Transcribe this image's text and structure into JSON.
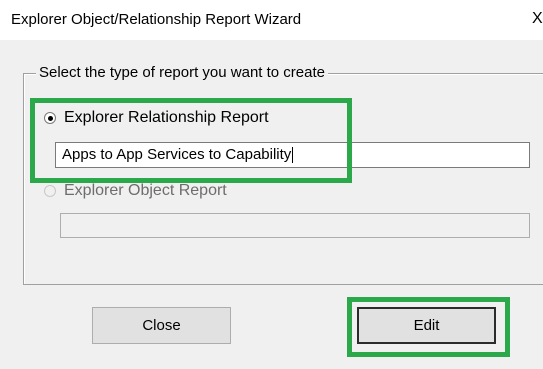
{
  "window": {
    "title": "Explorer Object/Relationship Report Wizard",
    "close_glyph": "X"
  },
  "group": {
    "legend": "Select the type of report you want to create"
  },
  "options": [
    {
      "label": "Explorer Relationship Report",
      "selected": true,
      "value": "Apps to App Services to Capability"
    },
    {
      "label": "Explorer Object Report",
      "selected": false,
      "value": ""
    }
  ],
  "buttons": {
    "close_label": "Close",
    "edit_label": "Edit"
  },
  "colors": {
    "highlight": "#2aa84a",
    "dialog_background": "#f0f0f0"
  }
}
